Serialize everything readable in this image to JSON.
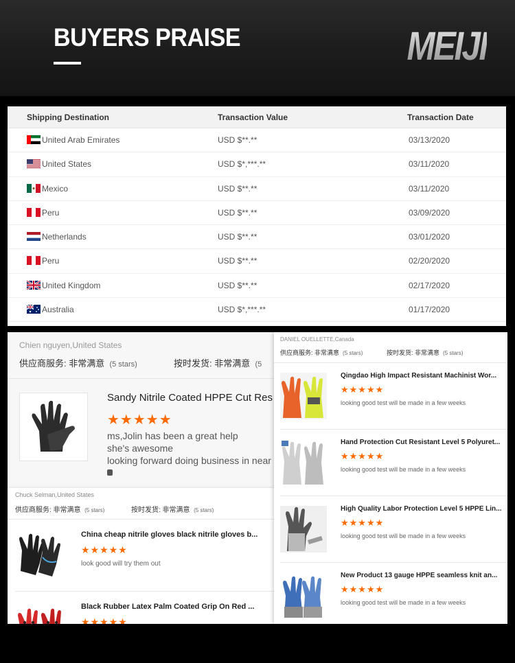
{
  "header": {
    "title": "BUYERS PRAISE",
    "logo": "MEIJI"
  },
  "transactions": {
    "columns": [
      "Shipping Destination",
      "Transaction Value",
      "Transaction Date"
    ],
    "rows": [
      {
        "flag": "uae",
        "country": "United Arab Emirates",
        "value": "USD $**.**",
        "date": "03/13/2020"
      },
      {
        "flag": "us",
        "country": "United States",
        "value": "USD $*,***.**",
        "date": "03/11/2020"
      },
      {
        "flag": "mx",
        "country": "Mexico",
        "value": "USD $**.**",
        "date": "03/11/2020"
      },
      {
        "flag": "pe",
        "country": "Peru",
        "value": "USD $**.**",
        "date": "03/09/2020"
      },
      {
        "flag": "nl",
        "country": "Netherlands",
        "value": "USD $**.**",
        "date": "03/01/2020"
      },
      {
        "flag": "pe",
        "country": "Peru",
        "value": "USD $**.**",
        "date": "02/20/2020"
      },
      {
        "flag": "uk",
        "country": "United Kingdom",
        "value": "USD $**.**",
        "date": "02/17/2020"
      },
      {
        "flag": "au",
        "country": "Australia",
        "value": "USD $*,***.**",
        "date": "01/17/2020"
      }
    ]
  },
  "review_a": {
    "reviewer": "Chien nguyen,United States",
    "service": "供应商服务: 非常满意",
    "service_stars": "(5 stars)",
    "delivery": "按时发货: 非常满意",
    "delivery_stars": "(5",
    "product": "Sandy Nitrile Coated HPPE Cut Res",
    "stars": "★★★★★",
    "comment_lines": [
      "ms,Jolin has been a great help",
      "she's awesome",
      "looking forward  doing business in near"
    ]
  },
  "review_b": {
    "reviewer": "Chuck Selman,United States",
    "service": "供应商服务: 非常满意",
    "service_stars": "(5 stars)",
    "delivery": "按时发货: 非常满意",
    "delivery_stars": "(5 stars)",
    "items": [
      {
        "title": "China cheap nitrile gloves black nitrile gloves b...",
        "stars": "★★★★★",
        "comment": "look good will try them out"
      },
      {
        "title": "Black Rubber Latex Palm Coated Grip On Red ...",
        "stars": "★★★★★",
        "comment": ""
      }
    ]
  },
  "review_c": {
    "reviewer": "DANIEL OUELLETTE,Canada",
    "service": "供应商服务: 非常满意",
    "service_stars": "(5 stars)",
    "delivery": "按时发货: 非常满意",
    "delivery_stars": "(5 stars)",
    "items": [
      {
        "title": "Qingdao High Impact Resistant Machinist Wor...",
        "stars": "★★★★★",
        "comment": "looking good test will be made in a few weeks"
      },
      {
        "title": "Hand Protection Cut Resistant Level 5 Polyuret...",
        "stars": "★★★★★",
        "comment": "looking good test will be made in a few weeks"
      },
      {
        "title": "High Quality Labor Protection Level 5 HPPE Lin...",
        "stars": "★★★★★",
        "comment": "looking good test will be made in a few weeks"
      },
      {
        "title": "New Product 13 gauge HPPE seamless knit an...",
        "stars": "★★★★★",
        "comment": "looking good test will be made in a few weeks"
      }
    ]
  },
  "colors": {
    "star": "#ff6a00",
    "header_bg": "#1e1e1e"
  }
}
